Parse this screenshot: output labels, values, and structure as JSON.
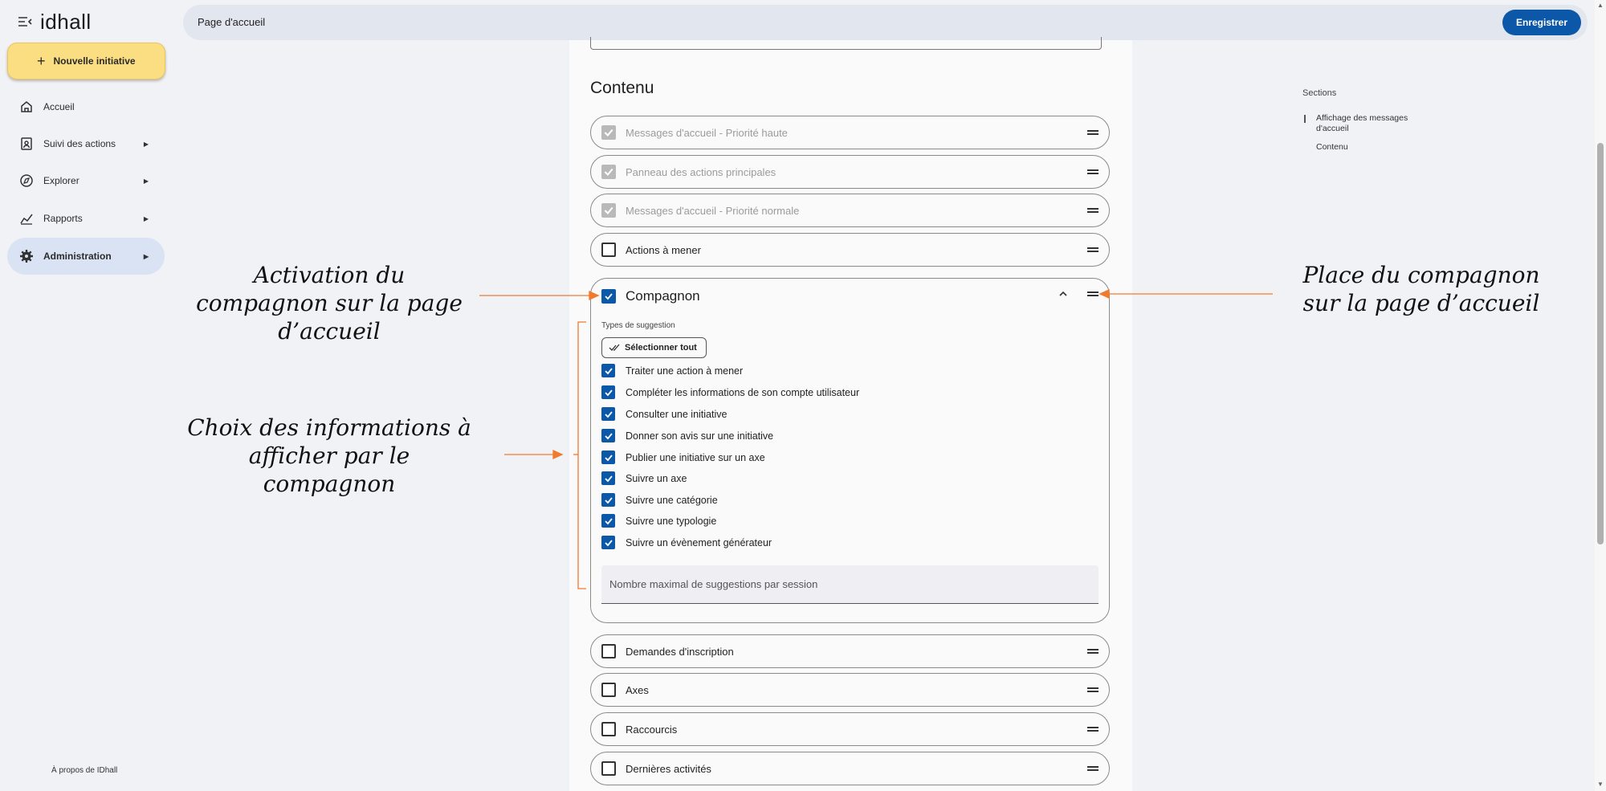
{
  "app": {
    "logo": "idhall"
  },
  "sidebar": {
    "new_button": "Nouvelle initiative",
    "items": [
      {
        "label": "Accueil",
        "icon": "home-icon"
      },
      {
        "label": "Suivi des actions",
        "icon": "clipboard-icon"
      },
      {
        "label": "Explorer",
        "icon": "compass-icon"
      },
      {
        "label": "Rapports",
        "icon": "chart-icon"
      },
      {
        "label": "Administration",
        "icon": "gear-icon"
      }
    ],
    "about": "À propos de IDhall"
  },
  "header": {
    "title": "Page d'accueil",
    "save_label": "Enregistrer"
  },
  "content": {
    "section_title": "Contenu",
    "rows_top": [
      {
        "label": "Messages d'accueil - Priorité haute",
        "checked": true,
        "disabled": true
      },
      {
        "label": "Panneau des actions principales",
        "checked": true,
        "disabled": true
      },
      {
        "label": "Messages d'accueil - Priorité normale",
        "checked": true,
        "disabled": true
      },
      {
        "label": "Actions à mener",
        "checked": false,
        "disabled": false
      }
    ],
    "companion": {
      "label": "Compagnon",
      "checked": true,
      "types_label": "Types de suggestion",
      "select_all": "Sélectionner tout",
      "suggestions": [
        "Traiter une action à mener",
        "Compléter les informations de son compte utilisateur",
        "Consulter une initiative",
        "Donner son avis sur une initiative",
        "Publier une initiative sur un axe",
        "Suivre un axe",
        "Suivre une catégorie",
        "Suivre une typologie",
        "Suivre un évènement générateur"
      ],
      "max_placeholder": "Nombre maximal de suggestions par session"
    },
    "rows_bottom": [
      {
        "label": "Demandes d'inscription",
        "checked": false
      },
      {
        "label": "Axes",
        "checked": false
      },
      {
        "label": "Raccourcis",
        "checked": false
      },
      {
        "label": "Dernières activités",
        "checked": false
      }
    ]
  },
  "toc": {
    "heading": "Sections",
    "items": [
      "Affichage des messages d'accueil",
      "Contenu"
    ]
  },
  "annotations": {
    "activation": "Activation du compagnon sur la page d’accueil",
    "choix": "Choix des informations à afficher par le compagnon",
    "place": "Place du compagnon sur la page d’accueil"
  },
  "colors": {
    "accent": "#0b57a8",
    "new_button": "#fbde82",
    "annotation_arrow": "#f07b2d"
  }
}
